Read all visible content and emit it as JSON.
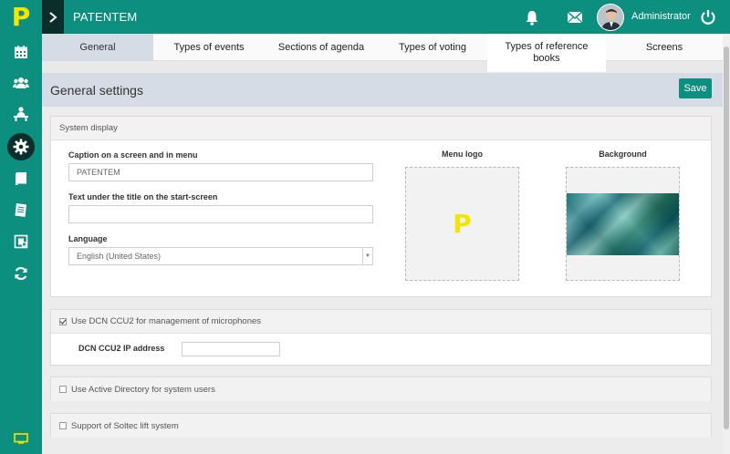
{
  "app": {
    "logo_letter": "P",
    "title": "PATENTEM",
    "user_name": "Administrator"
  },
  "icons": {
    "expand": "chevron-right-icon",
    "notifications": "bell-icon",
    "messages": "envelope-icon",
    "power": "power-icon"
  },
  "sidebar": {
    "items": [
      {
        "icon": "calendar-icon"
      },
      {
        "icon": "users-icon"
      },
      {
        "icon": "presenter-icon"
      },
      {
        "icon": "gear-icon",
        "active": true
      },
      {
        "icon": "book-icon"
      },
      {
        "icon": "document-icon"
      },
      {
        "icon": "screen-book-icon"
      },
      {
        "icon": "refresh-icon"
      }
    ],
    "bottom_icon": "monitor-icon"
  },
  "tabs": {
    "general": "General",
    "types_events": "Types of events",
    "sections_agenda": "Sections of agenda",
    "types_voting": "Types of voting",
    "types_reference_1": "Types of reference",
    "types_reference_2": "books",
    "screens": "Screens",
    "active": "General"
  },
  "header": {
    "title": "General settings",
    "save_label": "Save"
  },
  "system_display": {
    "title": "System display",
    "caption_label": "Caption on a screen and in menu",
    "caption_value": "PATENTEM",
    "subtitle_label": "Text under the title on the start-screen",
    "subtitle_value": "",
    "language_label": "Language",
    "language_value": "English (United States)",
    "menu_logo_label": "Menu logo",
    "menu_logo_letter": "P",
    "background_label": "Background"
  },
  "dcn": {
    "checked": true,
    "label": "Use DCN CCU2 for management of microphones",
    "ip_label": "DCN CCU2 IP address",
    "ip_value": ""
  },
  "active_directory": {
    "checked": false,
    "label": "Use Active Directory for system users"
  },
  "soltec": {
    "checked": false,
    "label": "Support of Soltec lift system"
  },
  "colors": {
    "primary": "#0c8f7e",
    "dark": "#0b2e2a",
    "logo_yellow": "#f2e600",
    "header_bg": "#d5dce5"
  }
}
